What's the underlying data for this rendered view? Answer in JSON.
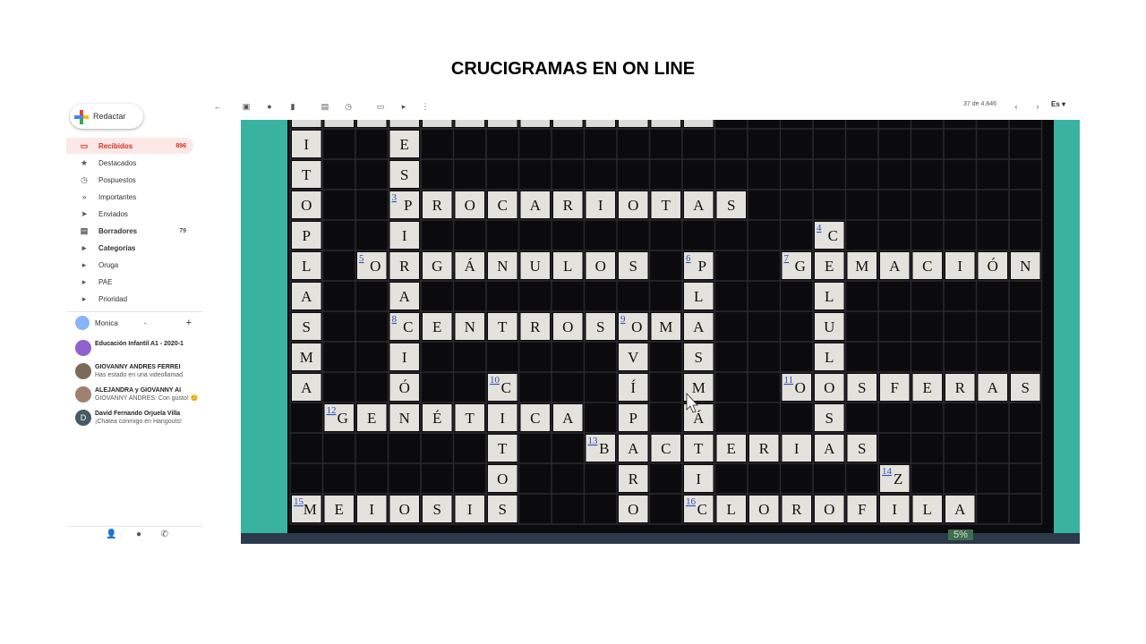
{
  "slide": {
    "title": "CRUCIGRAMAS EN ON LINE"
  },
  "gmail": {
    "compose_label": "Redactar",
    "nav": [
      {
        "label": "Recibidos",
        "count": "896",
        "icon": "inbox-icon",
        "glyph": "▭",
        "active": true,
        "bold": true
      },
      {
        "label": "Destacados",
        "count": "",
        "icon": "star-icon",
        "glyph": "★"
      },
      {
        "label": "Pospuestos",
        "count": "",
        "icon": "clock-icon",
        "glyph": "◷"
      },
      {
        "label": "Importantes",
        "count": "",
        "icon": "important-icon",
        "glyph": "»"
      },
      {
        "label": "Enviados",
        "count": "",
        "icon": "send-icon",
        "glyph": "➤"
      },
      {
        "label": "Borradores",
        "count": "79",
        "icon": "draft-icon",
        "glyph": "▤",
        "bold": true
      },
      {
        "label": "Categorías",
        "count": "",
        "icon": "label-icon",
        "glyph": "▸",
        "bold": true
      },
      {
        "label": "Oruga",
        "count": "",
        "icon": "label-icon",
        "glyph": "▸"
      },
      {
        "label": "PAE",
        "count": "",
        "icon": "label-icon",
        "glyph": "▸"
      },
      {
        "label": "Prioridad",
        "count": "",
        "icon": "label-icon",
        "glyph": "▸"
      }
    ],
    "account": {
      "name": "Monica",
      "caret": "-",
      "add": "+"
    },
    "chats": [
      {
        "line1": "Educación Infantil A1 - 2020-1",
        "line2": "",
        "color": "#8e63ce"
      },
      {
        "line1": "GIOVANNY ANDRES FERREI",
        "line2": "Has estado en una videollamad",
        "color": "#7a6a58"
      },
      {
        "line1": "ALEJANDRA y GIOVANNY AI",
        "line2": "GIOVANNY ANDRES: Con gusto! 😊",
        "color": "#a08070"
      },
      {
        "line1": "David Fernando Orjuela Villa",
        "line2": "¡Chatea conmigo en Hangouts!",
        "color": "#455a64",
        "initial": "D"
      }
    ],
    "bottom_icons": [
      "person-icon",
      "hangouts-icon",
      "phone-icon"
    ],
    "toolbar": {
      "pager": "37 de 4.846",
      "lang": "Es",
      "icons": [
        "back-icon",
        "archive-icon",
        "report-icon",
        "delete-icon",
        "mark-icon",
        "snooze-icon",
        "move-icon",
        "label-icon",
        "more-icon",
        "prev-icon",
        "next-icon"
      ]
    }
  },
  "crossword": {
    "words": [
      {
        "num": "",
        "dir": "down",
        "row": 0,
        "col": 0,
        "answer": "ITOPLASMA"
      },
      {
        "num": "",
        "dir": "down",
        "row": 0,
        "col": 3,
        "answer": "ESPIRACIÓ"
      },
      {
        "num": "3",
        "dir": "across",
        "row": 2,
        "col": 3,
        "answer": "PROCARIOTAS"
      },
      {
        "num": "4",
        "dir": "down",
        "row": 3,
        "col": 16,
        "answer": "CELULOS"
      },
      {
        "num": "5",
        "dir": "across",
        "row": 4,
        "col": 2,
        "answer": "ORGÁNULOS"
      },
      {
        "num": "6",
        "dir": "down",
        "row": 4,
        "col": 12,
        "answer": "PLASMÁTI"
      },
      {
        "num": "7",
        "dir": "across",
        "row": 4,
        "col": 15,
        "answer": "GEMACIÓN"
      },
      {
        "num": "8",
        "dir": "across",
        "row": 6,
        "col": 3,
        "answer": "CENTROSOMA"
      },
      {
        "num": "9",
        "dir": "down",
        "row": 6,
        "col": 10,
        "answer": "OVÍPARO"
      },
      {
        "num": "10",
        "dir": "down",
        "row": 8,
        "col": 6,
        "answer": "CITOS"
      },
      {
        "num": "11",
        "dir": "across",
        "row": 8,
        "col": 15,
        "answer": "OOSFERAS"
      },
      {
        "num": "12",
        "dir": "across",
        "row": 9,
        "col": 1,
        "answer": "GENÉTICA"
      },
      {
        "num": "13",
        "dir": "across",
        "row": 10,
        "col": 9,
        "answer": "BACTERIAS"
      },
      {
        "num": "14",
        "dir": "down",
        "row": 11,
        "col": 18,
        "answer": "Z"
      },
      {
        "num": "15",
        "dir": "across",
        "row": 12,
        "col": 0,
        "answer": "MEIOSIS"
      },
      {
        "num": "16",
        "dir": "across",
        "row": 12,
        "col": 12,
        "answer": "CLOROFILA"
      }
    ],
    "battery": "5%"
  }
}
